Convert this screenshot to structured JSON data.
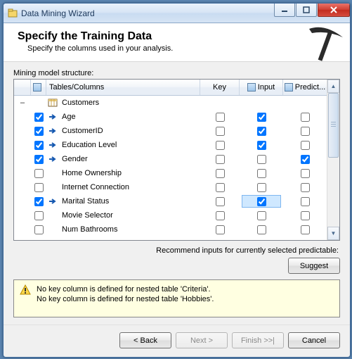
{
  "window": {
    "title": "Data Mining Wizard"
  },
  "header": {
    "title": "Specify the Training Data",
    "subtitle": "Specify the columns used in your analysis."
  },
  "grid": {
    "label": "Mining model structure:",
    "headers": {
      "tables_columns": "Tables/Columns",
      "key": "Key",
      "input": "Input",
      "predict": "Predict..."
    },
    "root": {
      "label": "Customers",
      "expanded": true
    },
    "rows": [
      {
        "label": "Age",
        "selected": true,
        "hasKeyIcon": true,
        "key": false,
        "input": true,
        "predict": false,
        "inputHighlighted": false
      },
      {
        "label": "CustomerID",
        "selected": true,
        "hasKeyIcon": true,
        "key": false,
        "input": true,
        "predict": false,
        "inputHighlighted": false
      },
      {
        "label": "Education Level",
        "selected": true,
        "hasKeyIcon": true,
        "key": false,
        "input": true,
        "predict": false,
        "inputHighlighted": false
      },
      {
        "label": "Gender",
        "selected": true,
        "hasKeyIcon": true,
        "key": false,
        "input": false,
        "predict": true,
        "inputHighlighted": false
      },
      {
        "label": "Home Ownership",
        "selected": false,
        "hasKeyIcon": false,
        "key": false,
        "input": false,
        "predict": false,
        "inputHighlighted": false
      },
      {
        "label": "Internet Connection",
        "selected": false,
        "hasKeyIcon": false,
        "key": false,
        "input": false,
        "predict": false,
        "inputHighlighted": false
      },
      {
        "label": "Marital Status",
        "selected": true,
        "hasKeyIcon": true,
        "key": false,
        "input": true,
        "predict": false,
        "inputHighlighted": true
      },
      {
        "label": "Movie Selector",
        "selected": false,
        "hasKeyIcon": false,
        "key": false,
        "input": false,
        "predict": false,
        "inputHighlighted": false
      },
      {
        "label": "Num Bathrooms",
        "selected": false,
        "hasKeyIcon": false,
        "key": false,
        "input": false,
        "predict": false,
        "inputHighlighted": false
      }
    ]
  },
  "recommend": {
    "text": "Recommend inputs for currently selected predictable:",
    "suggest": "Suggest"
  },
  "warning": {
    "line1": "No key column is defined for nested table 'Criteria'.",
    "line2": "No key column is defined for nested table 'Hobbies'."
  },
  "footer": {
    "back": "< Back",
    "next": "Next >",
    "finish": "Finish >>|",
    "cancel": "Cancel"
  }
}
